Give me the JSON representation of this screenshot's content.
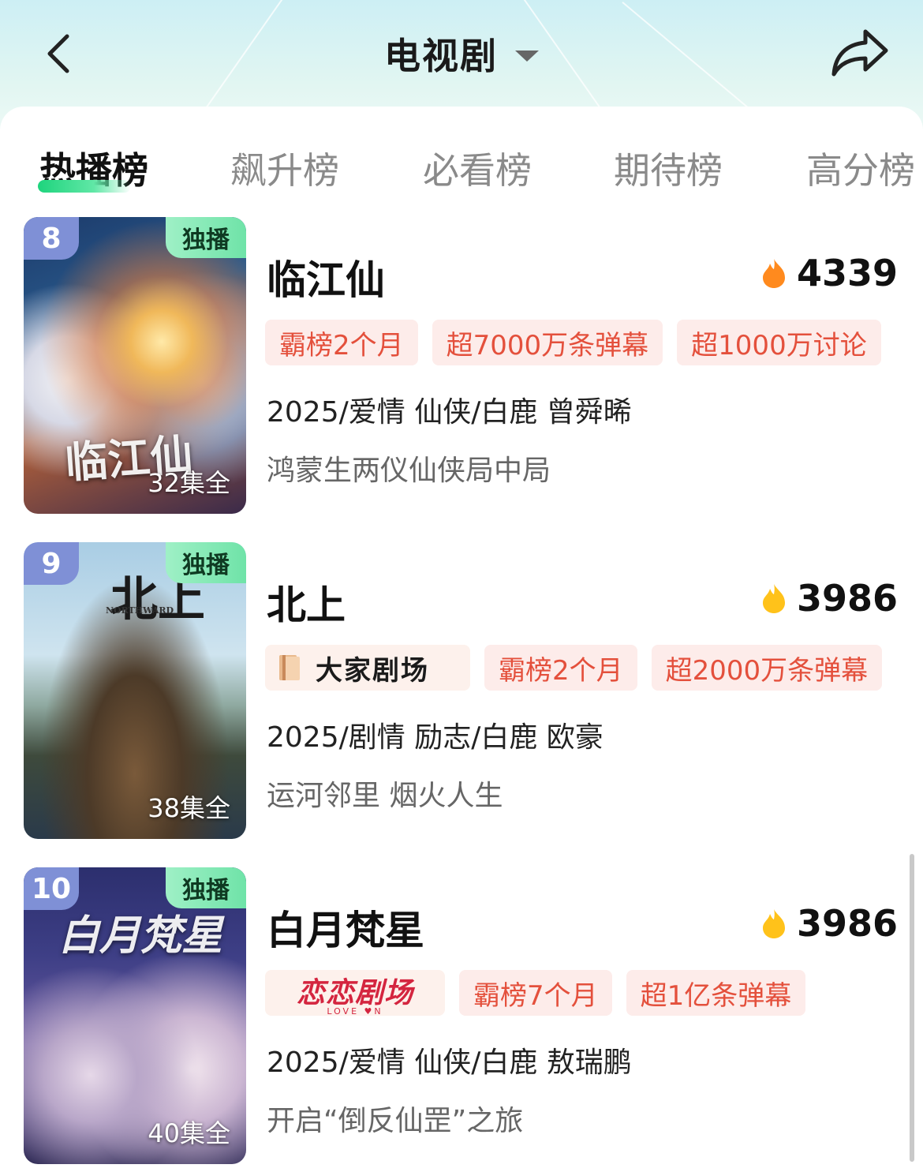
{
  "header": {
    "title": "电视剧",
    "back_icon": "chevron-left-icon",
    "share_icon": "share-arrow-icon"
  },
  "tabs": [
    {
      "label": "热播榜",
      "active": true
    },
    {
      "label": "飙升榜",
      "active": false
    },
    {
      "label": "必看榜",
      "active": false
    },
    {
      "label": "期待榜",
      "active": false
    },
    {
      "label": "高分榜",
      "active": false
    }
  ],
  "items": [
    {
      "rank": "8",
      "exclusive": "独播",
      "episodes": "32集全",
      "title": "临江仙",
      "heat": "4339",
      "heat_color": "#ff8a1e",
      "tags": [
        "霸榜2个月",
        "超7000万条弹幕",
        "超1000万讨论"
      ],
      "meta": "2025/爱情 仙侠/白鹿 曾舜晞",
      "desc": "鸿蒙生两仪仙侠局中局",
      "poster_title": "临江仙"
    },
    {
      "rank": "9",
      "exclusive": "独播",
      "episodes": "38集全",
      "title": "北上",
      "heat": "3986",
      "heat_color": "#ffc21a",
      "brand": "大家剧场",
      "tags": [
        "霸榜2个月",
        "超2000万条弹幕"
      ],
      "meta": "2025/剧情 励志/白鹿 欧豪",
      "desc": "运河邻里 烟火人生",
      "poster_title": "北上",
      "poster_subtitle": "NORTHWARD"
    },
    {
      "rank": "10",
      "exclusive": "独播",
      "episodes": "40集全",
      "title": "白月梵星",
      "heat": "3986",
      "heat_color": "#ffc21a",
      "brand": "恋恋剧场",
      "brand_sub": "LOVE ♥N",
      "tags": [
        "霸榜7个月",
        "超1亿条弹幕"
      ],
      "meta": "2025/爱情 仙侠/白鹿 敖瑞鹏",
      "desc": "开启“倒反仙罡”之旅",
      "poster_title": "白月梵星"
    }
  ]
}
